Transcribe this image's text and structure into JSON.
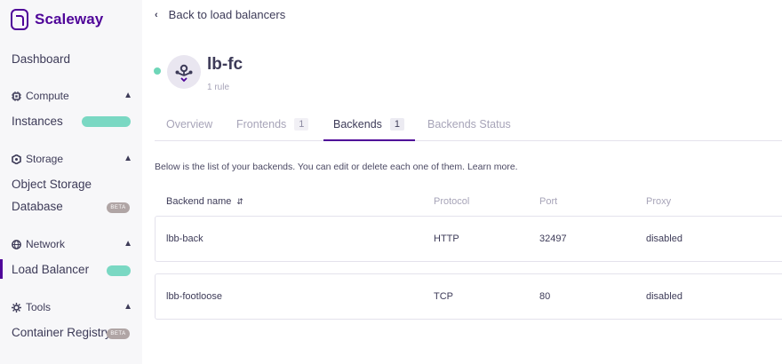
{
  "brand": {
    "name": "Scaleway",
    "color": "#4f0599"
  },
  "sidebar": {
    "dashboard": "Dashboard",
    "sections": [
      {
        "title": "Compute",
        "icon": "chip-icon",
        "items": [
          {
            "label": "Instances",
            "badge": ""
          }
        ]
      },
      {
        "title": "Storage",
        "icon": "hexagon-icon",
        "items": [
          {
            "label": "Object Storage",
            "badge": ""
          },
          {
            "label": "Database",
            "badge": "BETA"
          }
        ]
      },
      {
        "title": "Network",
        "icon": "globe-icon",
        "items": [
          {
            "label": "Load Balancer",
            "badge": "",
            "active": true
          }
        ]
      },
      {
        "title": "Tools",
        "icon": "gear-icon",
        "items": [
          {
            "label": "Container Registry",
            "badge": "BETA"
          }
        ]
      }
    ]
  },
  "header": {
    "back_label": "Back to load balancers",
    "lb_name": "lb-fc",
    "lb_subtitle": "1 rule",
    "status_color": "#6ed6b8"
  },
  "tabs": [
    {
      "label": "Overview",
      "count": ""
    },
    {
      "label": "Frontends",
      "count": "1"
    },
    {
      "label": "Backends",
      "count": "1",
      "active": true
    },
    {
      "label": "Backends Status",
      "count": ""
    }
  ],
  "intro_text": "Below is the list of your backends. You can edit or delete each one of them. Learn more.",
  "table": {
    "columns": [
      "Backend name",
      "Protocol",
      "Port",
      "Proxy"
    ],
    "rows": [
      {
        "name": "lbb-back",
        "protocol": "HTTP",
        "port": "32497",
        "proxy": "disabled"
      },
      {
        "name": "lbb-footloose",
        "protocol": "TCP",
        "port": "80",
        "proxy": "disabled"
      }
    ]
  }
}
